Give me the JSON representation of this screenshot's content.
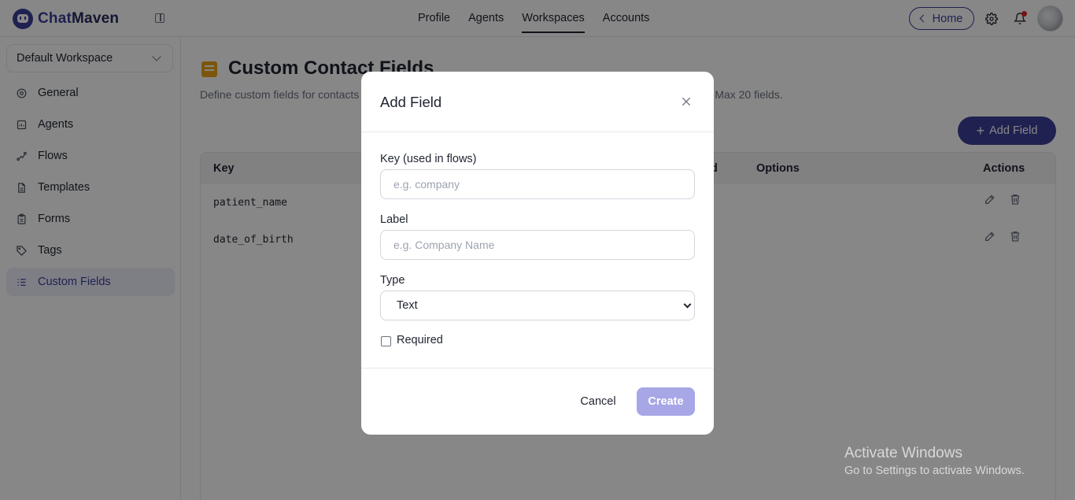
{
  "brand": {
    "name_part1": "Chat",
    "name_part2": "Maven"
  },
  "top_nav": {
    "tabs": [
      {
        "label": "Profile",
        "active": false
      },
      {
        "label": "Agents",
        "active": false
      },
      {
        "label": "Workspaces",
        "active": true
      },
      {
        "label": "Accounts",
        "active": false
      }
    ],
    "home_label": "Home",
    "icons": [
      "sidebar-collapse-icon",
      "gear-icon",
      "bell-icon",
      "avatar"
    ]
  },
  "sidebar": {
    "workspace": "Default Workspace",
    "items": [
      {
        "label": "General",
        "icon": "settings-icon",
        "active": false
      },
      {
        "label": "Agents",
        "icon": "agent-icon",
        "active": false
      },
      {
        "label": "Flows",
        "icon": "flow-icon",
        "active": false
      },
      {
        "label": "Templates",
        "icon": "document-icon",
        "active": false
      },
      {
        "label": "Forms",
        "icon": "clipboard-icon",
        "active": false
      },
      {
        "label": "Tags",
        "icon": "tag-icon",
        "active": false
      },
      {
        "label": "Custom Fields",
        "icon": "list-icon",
        "active": true
      }
    ]
  },
  "page": {
    "title": "Custom Contact Fields",
    "subtitle_left": "Define custom fields for contacts",
    "subtitle_right": "Max 20 fields.",
    "add_button": "Add Field"
  },
  "table": {
    "columns": {
      "key": "Key",
      "required_partial": "d",
      "options": "Options",
      "actions": "Actions"
    },
    "rows": [
      {
        "key": "patient_name"
      },
      {
        "key": "date_of_birth"
      }
    ]
  },
  "modal": {
    "title": "Add Field",
    "key_label": "Key (used in flows)",
    "key_placeholder": "e.g. company",
    "label_label": "Label",
    "label_placeholder": "e.g. Company Name",
    "type_label": "Type",
    "type_value": "Text",
    "required_label": "Required",
    "required_checked": false,
    "cancel_label": "Cancel",
    "create_label": "Create"
  },
  "watermark": {
    "title": "Activate Windows",
    "subtitle": "Go to Settings to activate Windows."
  },
  "colors": {
    "accent": "#3b3f9a",
    "active_bg": "#eef0fb",
    "title_icon": "#e8a217",
    "create_disabled": "#a7a6e6",
    "notification": "#e02424"
  }
}
